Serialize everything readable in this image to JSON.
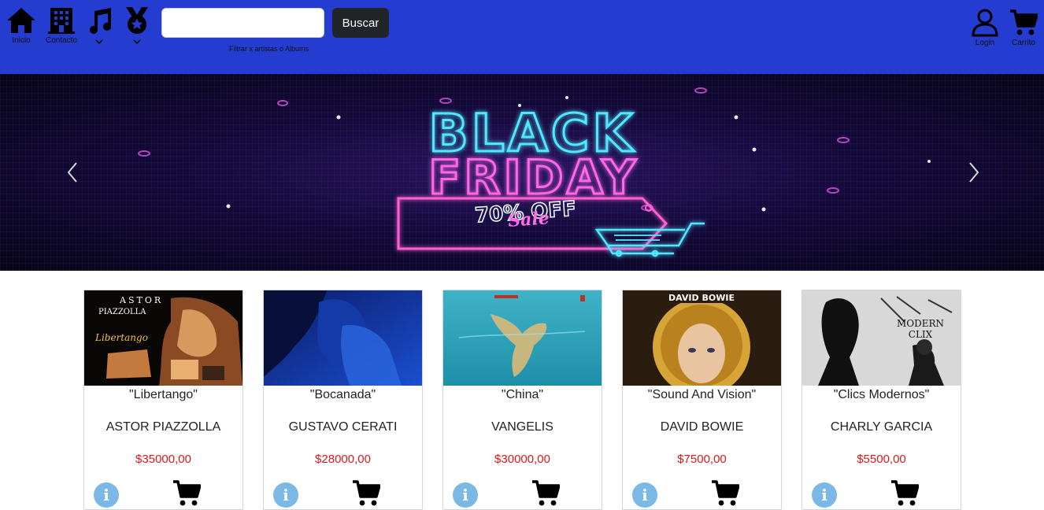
{
  "nav": {
    "home_label": "Inicio",
    "contact_label": "Contacto",
    "login_label": "Login",
    "cart_label": "Carrito"
  },
  "search": {
    "value": "",
    "placeholder": "",
    "button_label": "Buscar",
    "hint": "Filtrar x artistas o Albums"
  },
  "banner": {
    "line1": "BLACK",
    "line2": "FRIDAY",
    "line3": "70% OFF",
    "line4": "Sale"
  },
  "products": [
    {
      "title": "\"Libertango\"",
      "artist": "ASTOR PIAZZOLLA",
      "price": "$35000,00",
      "cover_text_1": "ASTOR",
      "cover_text_2": "PIAZZOLLA",
      "cover_text_3": "Libertango"
    },
    {
      "title": "\"Bocanada\"",
      "artist": "GUSTAVO CERATI",
      "price": "$28000,00"
    },
    {
      "title": "\"China\"",
      "artist": "VANGELIS",
      "price": "$30000,00"
    },
    {
      "title": "\"Sound And Vision\"",
      "artist": "DAVID BOWIE",
      "price": "$7500,00",
      "cover_text_1": "DAVID BOWIE"
    },
    {
      "title": "\"Clics Modernos\"",
      "artist": "CHARLY GARCIA",
      "price": "$5500,00",
      "cover_text_1": "MODERN",
      "cover_text_2": "CLIX"
    }
  ],
  "colors": {
    "header": "#243ccf",
    "price": "#d61a1a",
    "info": "#7ab8e6",
    "button": "#212529"
  }
}
